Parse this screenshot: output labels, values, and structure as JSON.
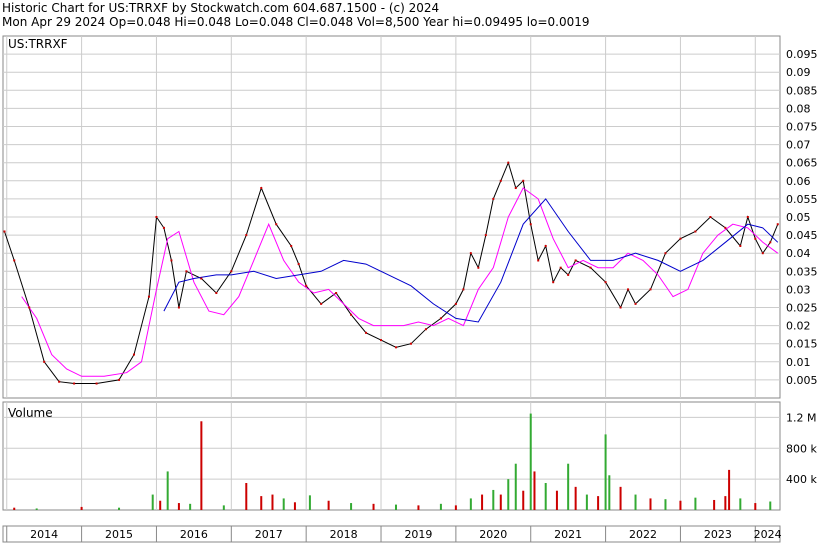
{
  "header": {
    "line1": "Historic Chart for US:TRRXF by Stockwatch.com 604.687.1500 - (c) 2024",
    "line2": "Mon Apr 29 2024   Op=0.048   Hi=0.048   Lo=0.048   Cl=0.048   Vol=8,500   Year hi=0.09495   lo=0.0019"
  },
  "chart_data": [
    {
      "type": "line",
      "title": "US:TRRXF",
      "ylim": [
        0,
        0.1
      ],
      "y_ticks": [
        0.005,
        0.01,
        0.015,
        0.02,
        0.025,
        0.03,
        0.035,
        0.04,
        0.045,
        0.05,
        0.055,
        0.06,
        0.065,
        0.07,
        0.075,
        0.08,
        0.085,
        0.09,
        0.095
      ],
      "y_tick_labels": [
        "0.005",
        "0.01",
        "0.015",
        "0.02",
        "0.025",
        "0.03",
        "0.035",
        "0.04",
        "0.045",
        "0.05",
        "0.055",
        "0.06",
        "0.065",
        "0.07",
        "0.075",
        "0.08",
        "0.085",
        "0.09",
        "0.095"
      ],
      "x_labels": [
        "2014",
        "2015",
        "2016",
        "2017",
        "2018",
        "2019",
        "2020",
        "2021",
        "2022",
        "2023",
        "2024"
      ],
      "x_range": [
        2013.95,
        2024.33
      ],
      "price": {
        "x": [
          2013.97,
          2014.1,
          2014.3,
          2014.5,
          2014.7,
          2014.9,
          2015.2,
          2015.5,
          2015.7,
          2015.9,
          2016.0,
          2016.1,
          2016.2,
          2016.3,
          2016.4,
          2016.6,
          2016.8,
          2017.0,
          2017.2,
          2017.4,
          2017.6,
          2017.8,
          2017.9,
          2018.0,
          2018.2,
          2018.4,
          2018.6,
          2018.8,
          2019.0,
          2019.2,
          2019.4,
          2019.6,
          2019.8,
          2020.0,
          2020.1,
          2020.2,
          2020.3,
          2020.4,
          2020.5,
          2020.6,
          2020.7,
          2020.8,
          2020.9,
          2021.0,
          2021.1,
          2021.2,
          2021.3,
          2021.4,
          2021.5,
          2021.6,
          2021.8,
          2022.0,
          2022.2,
          2022.3,
          2022.4,
          2022.6,
          2022.8,
          2023.0,
          2023.2,
          2023.4,
          2023.6,
          2023.8,
          2023.9,
          2024.0,
          2024.1,
          2024.2,
          2024.3
        ],
        "y": [
          0.046,
          0.038,
          0.025,
          0.01,
          0.0045,
          0.004,
          0.004,
          0.005,
          0.012,
          0.028,
          0.05,
          0.047,
          0.038,
          0.025,
          0.035,
          0.033,
          0.029,
          0.035,
          0.045,
          0.058,
          0.048,
          0.042,
          0.037,
          0.031,
          0.026,
          0.029,
          0.023,
          0.018,
          0.016,
          0.014,
          0.015,
          0.019,
          0.022,
          0.026,
          0.03,
          0.04,
          0.036,
          0.045,
          0.055,
          0.06,
          0.065,
          0.058,
          0.06,
          0.048,
          0.038,
          0.042,
          0.032,
          0.036,
          0.034,
          0.038,
          0.036,
          0.032,
          0.025,
          0.03,
          0.026,
          0.03,
          0.04,
          0.044,
          0.046,
          0.05,
          0.047,
          0.042,
          0.05,
          0.044,
          0.04,
          0.043,
          0.048
        ]
      },
      "ma_short": {
        "x": [
          2014.2,
          2014.4,
          2014.6,
          2014.8,
          2015.0,
          2015.3,
          2015.6,
          2015.8,
          2016.0,
          2016.15,
          2016.3,
          2016.5,
          2016.7,
          2016.9,
          2017.1,
          2017.3,
          2017.5,
          2017.7,
          2017.9,
          2018.1,
          2018.3,
          2018.5,
          2018.7,
          2018.9,
          2019.1,
          2019.3,
          2019.5,
          2019.7,
          2019.9,
          2020.1,
          2020.3,
          2020.5,
          2020.7,
          2020.9,
          2021.1,
          2021.3,
          2021.5,
          2021.7,
          2021.9,
          2022.1,
          2022.3,
          2022.5,
          2022.7,
          2022.9,
          2023.1,
          2023.3,
          2023.5,
          2023.7,
          2023.9,
          2024.1,
          2024.3
        ],
        "y": [
          0.028,
          0.022,
          0.012,
          0.008,
          0.006,
          0.006,
          0.007,
          0.01,
          0.03,
          0.044,
          0.046,
          0.032,
          0.024,
          0.023,
          0.028,
          0.038,
          0.048,
          0.038,
          0.032,
          0.029,
          0.03,
          0.026,
          0.022,
          0.02,
          0.02,
          0.02,
          0.021,
          0.02,
          0.022,
          0.02,
          0.03,
          0.036,
          0.05,
          0.058,
          0.055,
          0.044,
          0.036,
          0.038,
          0.036,
          0.036,
          0.04,
          0.038,
          0.034,
          0.028,
          0.03,
          0.04,
          0.045,
          0.048,
          0.047,
          0.043,
          0.04
        ]
      },
      "ma_long": {
        "x": [
          2016.1,
          2016.3,
          2016.5,
          2016.8,
          2017.0,
          2017.3,
          2017.6,
          2017.9,
          2018.2,
          2018.5,
          2018.8,
          2019.1,
          2019.4,
          2019.7,
          2020.0,
          2020.3,
          2020.6,
          2020.9,
          2021.2,
          2021.5,
          2021.8,
          2022.1,
          2022.4,
          2022.7,
          2023.0,
          2023.3,
          2023.6,
          2023.9,
          2024.1,
          2024.3
        ],
        "y": [
          0.024,
          0.032,
          0.033,
          0.034,
          0.034,
          0.035,
          0.033,
          0.034,
          0.035,
          0.038,
          0.037,
          0.034,
          0.031,
          0.026,
          0.022,
          0.021,
          0.032,
          0.048,
          0.055,
          0.046,
          0.038,
          0.038,
          0.04,
          0.038,
          0.035,
          0.038,
          0.043,
          0.048,
          0.047,
          0.043
        ]
      },
      "colors": {
        "price": "#000000",
        "ma_short": "#ff00ff",
        "ma_long": "#0000cc",
        "dots": "#cc0000",
        "grid": "#cccccc"
      }
    },
    {
      "type": "bar",
      "title": "Volume",
      "ylim": [
        0,
        1400000
      ],
      "y_ticks": [
        400000,
        800000,
        1200000
      ],
      "y_tick_labels": [
        "400 k",
        "800 k",
        "1.2 M"
      ],
      "bars": [
        {
          "x": 2014.1,
          "v": 30000,
          "c": "red"
        },
        {
          "x": 2014.4,
          "v": 20000,
          "c": "green"
        },
        {
          "x": 2015.0,
          "v": 40000,
          "c": "red"
        },
        {
          "x": 2015.5,
          "v": 30000,
          "c": "green"
        },
        {
          "x": 2015.95,
          "v": 200000,
          "c": "green"
        },
        {
          "x": 2016.05,
          "v": 120000,
          "c": "red"
        },
        {
          "x": 2016.15,
          "v": 500000,
          "c": "green"
        },
        {
          "x": 2016.3,
          "v": 90000,
          "c": "red"
        },
        {
          "x": 2016.45,
          "v": 80000,
          "c": "green"
        },
        {
          "x": 2016.6,
          "v": 1150000,
          "c": "red"
        },
        {
          "x": 2016.9,
          "v": 60000,
          "c": "green"
        },
        {
          "x": 2017.2,
          "v": 350000,
          "c": "red"
        },
        {
          "x": 2017.4,
          "v": 180000,
          "c": "red"
        },
        {
          "x": 2017.55,
          "v": 200000,
          "c": "red"
        },
        {
          "x": 2017.7,
          "v": 150000,
          "c": "green"
        },
        {
          "x": 2017.85,
          "v": 100000,
          "c": "red"
        },
        {
          "x": 2018.05,
          "v": 190000,
          "c": "green"
        },
        {
          "x": 2018.3,
          "v": 120000,
          "c": "red"
        },
        {
          "x": 2018.6,
          "v": 90000,
          "c": "green"
        },
        {
          "x": 2018.9,
          "v": 80000,
          "c": "red"
        },
        {
          "x": 2019.2,
          "v": 70000,
          "c": "green"
        },
        {
          "x": 2019.5,
          "v": 60000,
          "c": "red"
        },
        {
          "x": 2019.8,
          "v": 80000,
          "c": "green"
        },
        {
          "x": 2020.0,
          "v": 60000,
          "c": "red"
        },
        {
          "x": 2020.2,
          "v": 150000,
          "c": "green"
        },
        {
          "x": 2020.35,
          "v": 200000,
          "c": "red"
        },
        {
          "x": 2020.5,
          "v": 260000,
          "c": "green"
        },
        {
          "x": 2020.6,
          "v": 200000,
          "c": "red"
        },
        {
          "x": 2020.7,
          "v": 400000,
          "c": "green"
        },
        {
          "x": 2020.8,
          "v": 600000,
          "c": "green"
        },
        {
          "x": 2020.9,
          "v": 250000,
          "c": "red"
        },
        {
          "x": 2021.0,
          "v": 1250000,
          "c": "green"
        },
        {
          "x": 2021.05,
          "v": 500000,
          "c": "red"
        },
        {
          "x": 2021.2,
          "v": 350000,
          "c": "green"
        },
        {
          "x": 2021.35,
          "v": 250000,
          "c": "red"
        },
        {
          "x": 2021.5,
          "v": 600000,
          "c": "green"
        },
        {
          "x": 2021.6,
          "v": 300000,
          "c": "red"
        },
        {
          "x": 2021.75,
          "v": 200000,
          "c": "green"
        },
        {
          "x": 2021.9,
          "v": 180000,
          "c": "red"
        },
        {
          "x": 2022.0,
          "v": 980000,
          "c": "green"
        },
        {
          "x": 2022.05,
          "v": 450000,
          "c": "green"
        },
        {
          "x": 2022.2,
          "v": 300000,
          "c": "red"
        },
        {
          "x": 2022.4,
          "v": 200000,
          "c": "green"
        },
        {
          "x": 2022.6,
          "v": 150000,
          "c": "red"
        },
        {
          "x": 2022.8,
          "v": 140000,
          "c": "green"
        },
        {
          "x": 2023.0,
          "v": 120000,
          "c": "red"
        },
        {
          "x": 2023.2,
          "v": 160000,
          "c": "green"
        },
        {
          "x": 2023.45,
          "v": 130000,
          "c": "red"
        },
        {
          "x": 2023.6,
          "v": 180000,
          "c": "red"
        },
        {
          "x": 2023.65,
          "v": 520000,
          "c": "red"
        },
        {
          "x": 2023.8,
          "v": 150000,
          "c": "green"
        },
        {
          "x": 2024.0,
          "v": 90000,
          "c": "red"
        },
        {
          "x": 2024.2,
          "v": 110000,
          "c": "green"
        }
      ],
      "colors": {
        "up": "#33aa33",
        "down": "#cc0000"
      }
    }
  ]
}
